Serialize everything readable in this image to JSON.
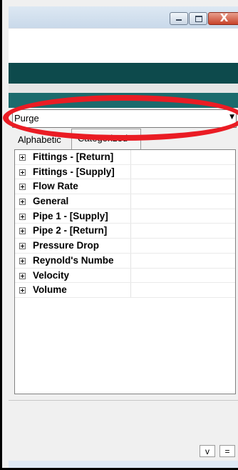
{
  "window": {
    "close_glyph": "X"
  },
  "property_panel": {
    "combo_value": "Purge",
    "tabs": [
      {
        "label": "Alphabetic"
      },
      {
        "label": "Categorized"
      }
    ],
    "categories": [
      {
        "label": "Fittings - [Return]"
      },
      {
        "label": "Fittings - [Supply]"
      },
      {
        "label": "Flow Rate"
      },
      {
        "label": "General"
      },
      {
        "label": "Pipe 1 - [Supply]"
      },
      {
        "label": "Pipe 2 - [Return]"
      },
      {
        "label": "Pressure Drop"
      },
      {
        "label": "Reynold's Numbe"
      },
      {
        "label": "Velocity"
      },
      {
        "label": "Volume"
      }
    ]
  },
  "bottom_buttons": {
    "v_label": "v",
    "eq_label": "="
  },
  "colors": {
    "dark_band": "#0d4a4c",
    "dock_header": "#1c6b6d",
    "annotation": "#ea1c24"
  }
}
